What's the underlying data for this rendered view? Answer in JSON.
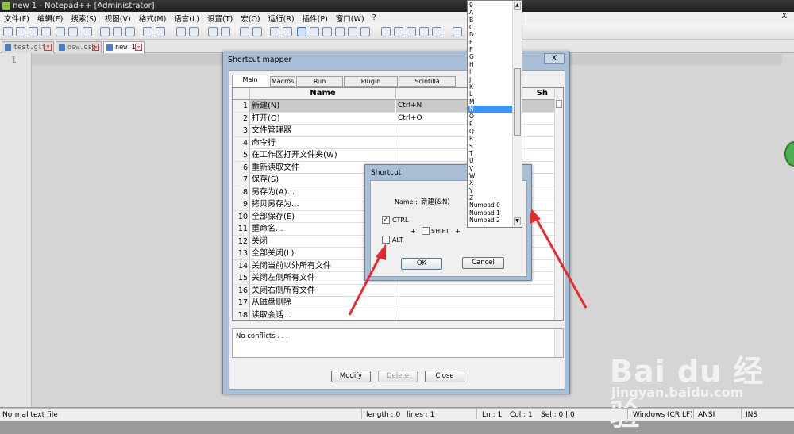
{
  "window": {
    "title": "new 1 - Notepad++ [Administrator]"
  },
  "menu": {
    "items": [
      "文件(F)",
      "编辑(E)",
      "搜索(S)",
      "视图(V)",
      "格式(M)",
      "语言(L)",
      "设置(T)",
      "宏(O)",
      "运行(R)",
      "插件(P)",
      "窗口(W)",
      "?"
    ],
    "close": "X"
  },
  "tabs": [
    {
      "label": "test.gltf"
    },
    {
      "label": "osw.osg"
    },
    {
      "label": "new 1"
    }
  ],
  "editor": {
    "line_number": "1"
  },
  "status": {
    "file_type": "Normal text file",
    "length": "length : 0",
    "lines": "lines : 1",
    "ln": "Ln : 1",
    "col": "Col : 1",
    "sel": "Sel : 0 | 0",
    "eol": "Windows (CR LF)",
    "encoding": "ANSI",
    "mode": "INS"
  },
  "mapper": {
    "title": "Shortcut mapper",
    "close": "X",
    "tabs": [
      "Main menu",
      "Macros",
      "Run commands",
      "Plugin commands",
      "Scintilla commands"
    ],
    "col_name": "Name",
    "col_shortcut": "Sh",
    "rows": [
      {
        "num": "1",
        "name": "新建(N)",
        "shortcut": "Ctrl+N",
        "selected": true
      },
      {
        "num": "2",
        "name": "打开(O)",
        "shortcut": "Ctrl+O"
      },
      {
        "num": "3",
        "name": "文件管理器",
        "shortcut": ""
      },
      {
        "num": "4",
        "name": "命令行",
        "shortcut": ""
      },
      {
        "num": "5",
        "name": "在工作区打开文件夹(W)",
        "shortcut": ""
      },
      {
        "num": "6",
        "name": "重新读取文件",
        "shortcut": ""
      },
      {
        "num": "7",
        "name": "保存(S)",
        "shortcut": ""
      },
      {
        "num": "8",
        "name": "另存为(A)...",
        "shortcut": ""
      },
      {
        "num": "9",
        "name": "拷贝另存为...",
        "shortcut": ""
      },
      {
        "num": "10",
        "name": "全部保存(E)",
        "shortcut": ""
      },
      {
        "num": "11",
        "name": "重命名...",
        "shortcut": ""
      },
      {
        "num": "12",
        "name": "关闭",
        "shortcut": ""
      },
      {
        "num": "13",
        "name": "全部关闭(L)",
        "shortcut": ""
      },
      {
        "num": "14",
        "name": "关闭当前以外所有文件",
        "shortcut": ""
      },
      {
        "num": "15",
        "name": "关闭左侧所有文件",
        "shortcut": ""
      },
      {
        "num": "16",
        "name": "关闭右侧所有文件",
        "shortcut": ""
      },
      {
        "num": "17",
        "name": "从磁盘删除",
        "shortcut": ""
      },
      {
        "num": "18",
        "name": "读取会话...",
        "shortcut": ""
      }
    ],
    "conflicts": "No conflicts . . .",
    "buttons": {
      "modify": "Modify",
      "delete": "Delete",
      "close": "Close"
    }
  },
  "shortcut_dialog": {
    "title": "Shortcut",
    "name_label": "Name :",
    "name_value": "新建(&N)",
    "ctrl": {
      "label": "CTRL",
      "checked": true
    },
    "alt": {
      "label": "ALT",
      "checked": false
    },
    "shift": {
      "label": "SHIFT",
      "checked": false
    },
    "plus1": "+",
    "plus2": "+",
    "ok": "OK",
    "cancel": "Cancel"
  },
  "key_list": {
    "items": [
      "9",
      "A",
      "B",
      "C",
      "D",
      "E",
      "F",
      "G",
      "H",
      "I",
      "J",
      "K",
      "L",
      "M",
      "N",
      "O",
      "P",
      "Q",
      "R",
      "S",
      "T",
      "U",
      "V",
      "W",
      "X",
      "Y",
      "Z",
      "Numpad 0",
      "Numpad 1",
      "Numpad 2"
    ],
    "selected": "N"
  },
  "watermark": {
    "brand": "Bai du 经验",
    "url": "jingyan.baidu.com"
  },
  "colors": {
    "arrow": "#e8292a",
    "selection": "#3399ff",
    "dialog_frame": "#a9bfd6"
  }
}
